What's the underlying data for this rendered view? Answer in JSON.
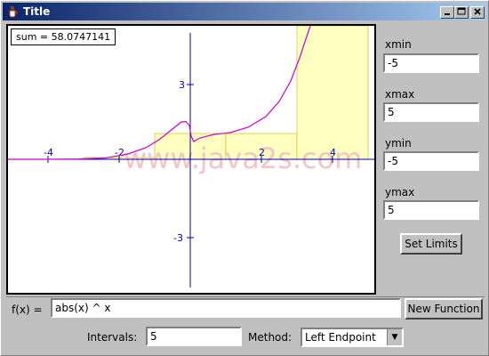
{
  "window": {
    "title": "Title"
  },
  "plot": {
    "sum_text": "sum = 58.0747141",
    "x_ticks": [
      "-4",
      "-2",
      "2",
      "4"
    ],
    "y_ticks": [
      "3",
      "-3"
    ],
    "watermark": "www.java2s.com",
    "colors": {
      "curve": "#cc00cc",
      "axes": "#0000aa",
      "rects": "#ffffc0",
      "rect_border": "#c8b400"
    }
  },
  "limits": {
    "xmin_label": "xmin",
    "xmin_value": "-5",
    "xmax_label": "xmax",
    "xmax_value": "5",
    "ymin_label": "ymin",
    "ymin_value": "-5",
    "ymax_label": "ymax",
    "ymax_value": "5",
    "set_limits_label": "Set Limits"
  },
  "function": {
    "label": "f(x) =",
    "value": "abs(x) ^ x",
    "new_function_label": "New Function"
  },
  "controls": {
    "intervals_label": "Intervals:",
    "intervals_value": "5",
    "method_label": "Method:",
    "method_value": "Left Endpoint"
  }
}
